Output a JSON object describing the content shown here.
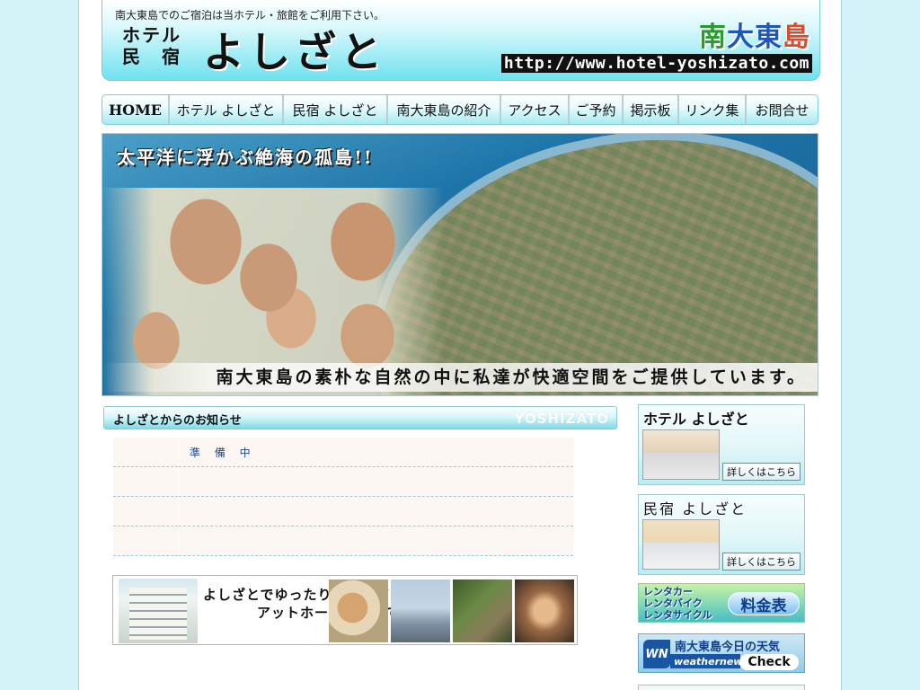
{
  "header": {
    "tagline": "南大東島でのご宿泊は当ホテル・旅館をご利用下さい。",
    "kind_line1": "ホテル",
    "kind_line2": "民　宿",
    "name": "よしざと",
    "island_chars": [
      "南",
      "大",
      "東",
      "島"
    ],
    "island_colors": [
      "#2a9b2f",
      "#1f57b8",
      "#1f57b8",
      "#e04a2c"
    ],
    "url": "http://www.hotel-yoshizato.com"
  },
  "nav": {
    "items": [
      {
        "label": "HOME"
      },
      {
        "label": "ホテル よしざと"
      },
      {
        "label": "民宿 よしざと"
      },
      {
        "label": "南大東島の紹介"
      },
      {
        "label": "アクセス"
      },
      {
        "label": "ご予約"
      },
      {
        "label": "掲示板"
      },
      {
        "label": "リンク集"
      },
      {
        "label": "お問合せ"
      }
    ]
  },
  "banner": {
    "headline": "太平洋に浮かぶ絶海の孤島!!",
    "subline": "南大東島の素朴な自然の中に私達が快適空間をご提供しています。"
  },
  "news": {
    "title": "よしざとからのお知らせ",
    "watermark": "YOSHIZATO",
    "rows": [
      {
        "date": "",
        "text": "準 備 中"
      },
      {
        "date": "",
        "text": ""
      },
      {
        "date": "",
        "text": ""
      },
      {
        "date": "",
        "text": ""
      }
    ]
  },
  "promo": {
    "line1": "よしざとでゆったり・のんびり",
    "line2": "アットホームなおもてなし"
  },
  "side": {
    "hotel_title": "ホテル よしざと",
    "hotel_more": "詳しくはこちら",
    "minshuku_title": "民宿 よしざと",
    "minshuku_more": "詳しくはこちら",
    "rental_lines": [
      "レンタカー",
      "レンタバイク",
      "レンタサイクル"
    ],
    "rental_price": "料金表",
    "weather_logo": "WN",
    "weather_title": "南大東島今日の天気",
    "weather_brand": "weathernews",
    "weather_button": "Check"
  }
}
